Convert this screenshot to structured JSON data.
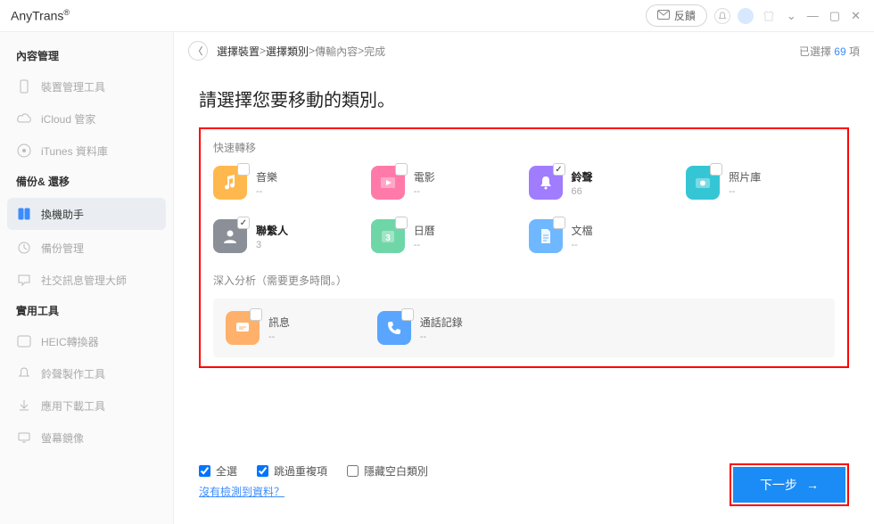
{
  "brand": "AnyTrans",
  "titlebar": {
    "feedback": "反饋"
  },
  "sidebar": {
    "section1": "內容管理",
    "items1": [
      {
        "label": "裝置管理工具"
      },
      {
        "label": "iCloud 管家"
      },
      {
        "label": "iTunes 資料庫"
      }
    ],
    "section2": "備份& 還移",
    "items2": [
      {
        "label": "換機助手"
      },
      {
        "label": "備份管理"
      },
      {
        "label": "社交訊息管理大師"
      }
    ],
    "section3": "實用工具",
    "items3": [
      {
        "label": "HEIC轉換器"
      },
      {
        "label": "鈴聲製作工具"
      },
      {
        "label": "應用下載工具"
      },
      {
        "label": "螢幕鏡像"
      }
    ]
  },
  "crumbs": {
    "c1": "選擇裝置",
    "c2": "選擇類別",
    "c3": "傳輸內容",
    "c4": "完成",
    "sep": " > "
  },
  "selected": {
    "prefix": "已選擇 ",
    "count": "69",
    "suffix": " 項"
  },
  "heading": "請選擇您要移動的類別。",
  "group_quick": "快速轉移",
  "group_deep": "深入分析（需要更多時間。）",
  "categories_quick": [
    {
      "key": "music",
      "label": "音樂",
      "count": "--",
      "bold": false,
      "checked": false,
      "bg": "#ffb84d"
    },
    {
      "key": "movies",
      "label": "電影",
      "count": "--",
      "bold": false,
      "checked": false,
      "bg": "#ff7aa8"
    },
    {
      "key": "ringtone",
      "label": "鈴聲",
      "count": "66",
      "bold": true,
      "checked": true,
      "bg": "#a07cff"
    },
    {
      "key": "photos",
      "label": "照片庫",
      "count": "--",
      "bold": false,
      "checked": false,
      "bg": "#35c6d6"
    },
    {
      "key": "contacts",
      "label": "聯繫人",
      "count": "3",
      "bold": true,
      "checked": true,
      "bg": "#8a8f98"
    },
    {
      "key": "calendar",
      "label": "日曆",
      "count": "--",
      "bold": false,
      "checked": false,
      "bg": "#6fd6a8"
    },
    {
      "key": "files",
      "label": "文檔",
      "count": "--",
      "bold": false,
      "checked": false,
      "bg": "#6fb8ff"
    }
  ],
  "categories_deep": [
    {
      "key": "messages",
      "label": "訊息",
      "count": "--",
      "bold": false,
      "checked": false,
      "bg": "#ffb16b"
    },
    {
      "key": "calllog",
      "label": "通話記錄",
      "count": "--",
      "bold": false,
      "checked": false,
      "bg": "#5aa6ff"
    }
  ],
  "footer": {
    "select_all": "全選",
    "skip_dup": "跳過重複項",
    "hide_empty": "隱藏空白類別",
    "missing_link": "沒有檢測到資料？",
    "next": "下一步"
  }
}
